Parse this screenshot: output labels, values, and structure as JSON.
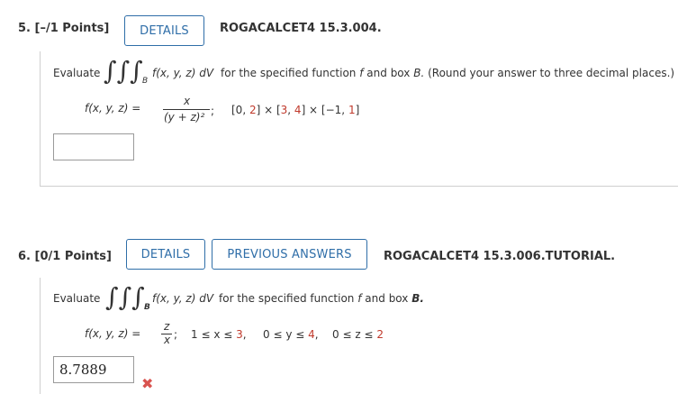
{
  "q5": {
    "number": "5. [–/1 Points]",
    "details_label": "DETAILS",
    "code": "ROGACALCET4 15.3.004.",
    "evaluate": "Evaluate",
    "integrand": "f(x, y, z) dV",
    "instruction_a": "for the specified function",
    "instruction_f": "f",
    "instruction_b": "and box",
    "instruction_B": "B.",
    "instruction_c": "(Round your answer to three decimal places.)",
    "func_lhs": "f(x, y, z) =",
    "numerator": "x",
    "denominator": "(y + z)²",
    "semicolon": ";",
    "box_prefix": "[0, ",
    "box_1": "2",
    "box_mid1": "] × [",
    "box_2": "3",
    "box_comma": ", ",
    "box_3": "4",
    "box_mid2": "] × [−1, ",
    "box_4": "1",
    "box_end": "]",
    "answer_value": ""
  },
  "q6": {
    "number": "6. [0/1 Points]",
    "details_label": "DETAILS",
    "prev_label": "PREVIOUS ANSWERS",
    "code": "ROGACALCET4 15.3.006.TUTORIAL.",
    "evaluate": "Evaluate",
    "integrand": "f(x, y, z) dV",
    "instruction_a": "for the specified function",
    "instruction_f": "f",
    "instruction_b": "and box",
    "instruction_B": "B.",
    "func_lhs": "f(x, y, z) =",
    "numerator": "z",
    "denominator": "x",
    "semicolon": ";",
    "range_x_a": "1 ≤ x ≤ ",
    "range_x_b": "3",
    "range_y_a": "0 ≤ y ≤ ",
    "range_y_b": "4",
    "range_z_a": "0 ≤ z ≤ ",
    "range_z_b": "2",
    "answer_value": "8.7889",
    "status": "incorrect"
  },
  "colors": {
    "link_blue": "#2f6ea8",
    "highlight_red": "#c0392b",
    "error_red": "#d9534f"
  },
  "icons": {
    "incorrect": "x-mark-icon",
    "integral": "triple-integral-symbol"
  }
}
